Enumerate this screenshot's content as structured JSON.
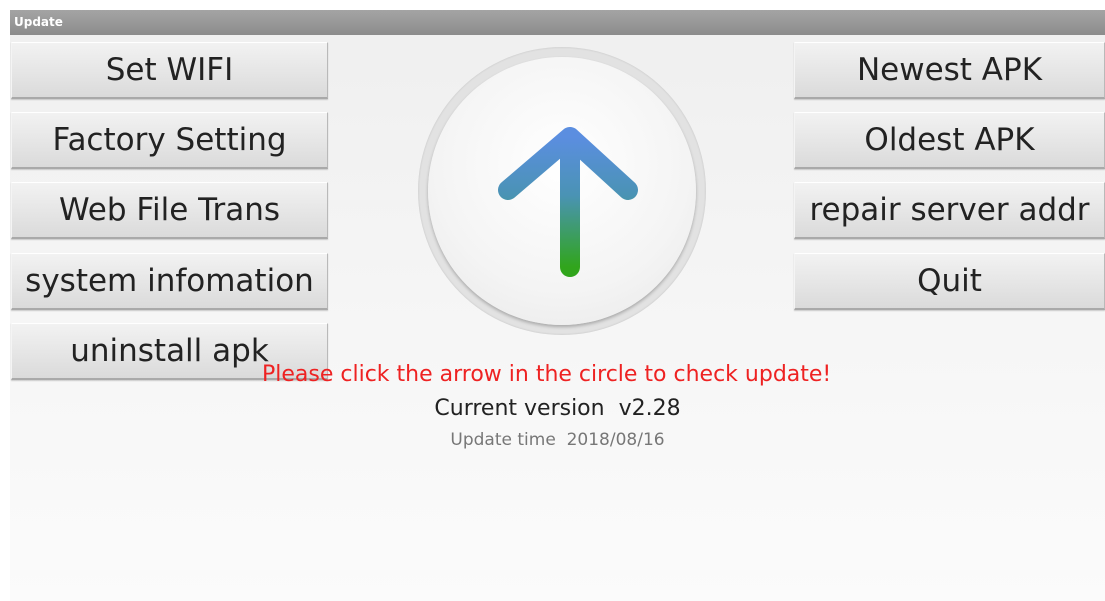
{
  "window": {
    "title": "Update"
  },
  "left_buttons": [
    {
      "label": "Set WIFI"
    },
    {
      "label": "Factory Setting"
    },
    {
      "label": "Web File Trans"
    },
    {
      "label": "system infomation"
    },
    {
      "label": "uninstall apk"
    }
  ],
  "right_buttons": [
    {
      "label": "Newest APK"
    },
    {
      "label": "Oldest APK"
    },
    {
      "label": "repair server addr"
    },
    {
      "label": "Quit"
    }
  ],
  "update_circle": {
    "icon": "arrow-up-icon",
    "colors": {
      "top": "#5b8ee0",
      "bottom": "#31a51c"
    }
  },
  "status": {
    "hint": "Please click the arrow in the circle to check update!",
    "hint_color": "#ee2222",
    "current_version_label": "Current version",
    "current_version_value": "v2.28",
    "update_time_label": "Update time",
    "update_time_value": "2018/08/16"
  }
}
